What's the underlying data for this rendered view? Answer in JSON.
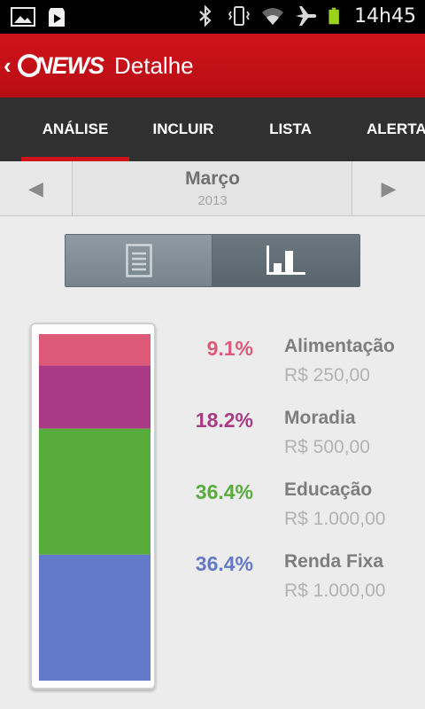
{
  "status_bar": {
    "time": "14h45",
    "icons": [
      "image-icon",
      "play-store-icon",
      "bluetooth-icon",
      "vibrate-icon",
      "wifi-icon",
      "airplane-icon",
      "battery-icon"
    ]
  },
  "app_bar": {
    "logo_text": "NEWS",
    "title": "Detalhe"
  },
  "tabs": [
    {
      "label": "ANÁLISE",
      "selected": true
    },
    {
      "label": "INCLUIR",
      "selected": false
    },
    {
      "label": "LISTA",
      "selected": false
    },
    {
      "label": "ALERTAS",
      "selected": false
    }
  ],
  "period": {
    "month": "Março",
    "year": "2013",
    "prev_icon": "arrow-left-icon",
    "next_icon": "arrow-right-icon"
  },
  "view_toggle": {
    "options": [
      "list-view-icon",
      "chart-view-icon"
    ],
    "selected": "chart-view-icon"
  },
  "colors": {
    "accent": "#d0131b",
    "alimentacao": "#dc5a78",
    "moradia": "#a93a86",
    "educacao": "#57ac3a",
    "renda_fixa": "#6379c9"
  },
  "chart_data": {
    "type": "bar",
    "stacked": true,
    "categories": [
      "Alimentação",
      "Moradia",
      "Educação",
      "Renda Fixa"
    ],
    "values": [
      250,
      500,
      1000,
      1000
    ],
    "percent": [
      9.1,
      18.2,
      36.4,
      36.4
    ]
  },
  "legend": [
    {
      "percent": "9.1%",
      "name": "Alimentação",
      "amount": "R$ 250,00",
      "color": "#dc5a78"
    },
    {
      "percent": "18.2%",
      "name": "Moradia",
      "amount": "R$ 500,00",
      "color": "#a93a86"
    },
    {
      "percent": "36.4%",
      "name": "Educação",
      "amount": "R$ 1.000,00",
      "color": "#57ac3a"
    },
    {
      "percent": "36.4%",
      "name": "Renda Fixa",
      "amount": "R$ 1.000,00",
      "color": "#6379c9"
    }
  ]
}
